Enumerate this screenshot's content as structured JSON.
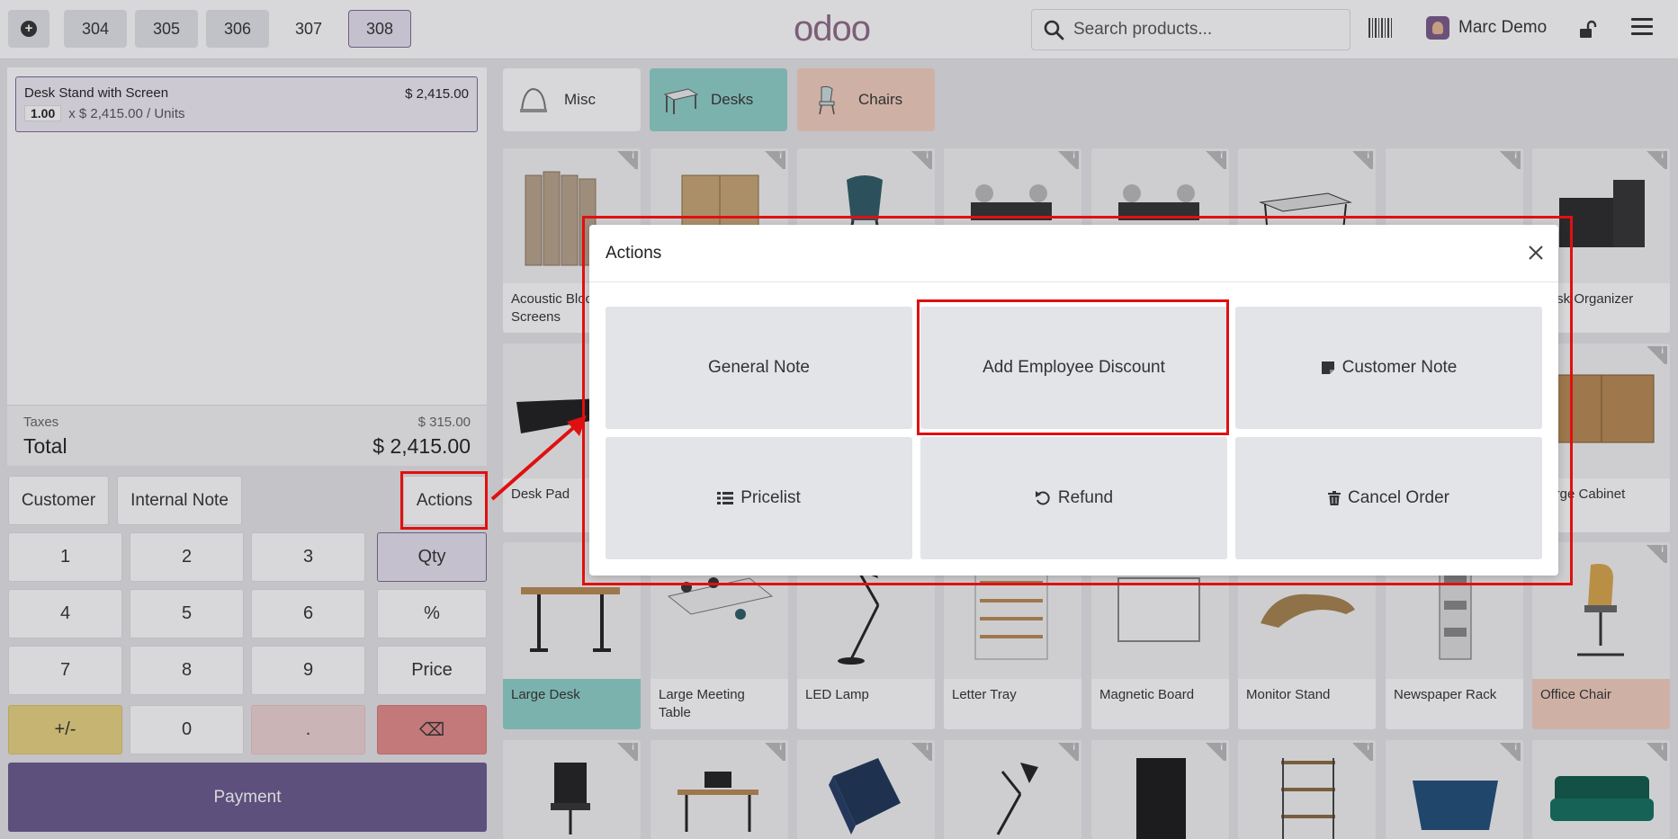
{
  "topbar": {
    "new_order_icon": "plus-circle-icon",
    "tabs": [
      "304",
      "305",
      "306",
      "307",
      "308"
    ],
    "active_tab": "308",
    "logo": "odoo",
    "search_placeholder": "Search products...",
    "user_name": "Marc Demo"
  },
  "order": {
    "line": {
      "name": "Desk Stand with Screen",
      "price": "$ 2,415.00",
      "qty": "1.00",
      "unit_price": "x $ 2,415.00 / Units"
    },
    "taxes_label": "Taxes",
    "taxes_value": "$ 315.00",
    "total_label": "Total",
    "total_value": "$ 2,415.00"
  },
  "controls": {
    "customer": "Customer",
    "internal_note": "Internal Note",
    "actions": "Actions"
  },
  "numpad": {
    "k1": "1",
    "k2": "2",
    "k3": "3",
    "k4": "4",
    "k5": "5",
    "k6": "6",
    "k7": "7",
    "k8": "8",
    "k9": "9",
    "k0": "0",
    "dot": ".",
    "plusminus": "+/-",
    "qty": "Qty",
    "percent": "%",
    "price": "Price",
    "backspace": "⌫"
  },
  "payment": "Payment",
  "categories": [
    "Misc",
    "Desks",
    "Chairs"
  ],
  "products": {
    "row1_first": "Acoustic Bloc Screens",
    "row1_last": "Desk Organizer",
    "row2_first": "Desk Pad",
    "row2_last": "Large Cabinet",
    "row3": [
      "Large Desk",
      "Large Meeting Table",
      "LED Lamp",
      "Letter Tray",
      "Magnetic Board",
      "Monitor Stand",
      "Newspaper Rack",
      "Office Chair"
    ]
  },
  "modal": {
    "title": "Actions",
    "buttons": {
      "general_note": "General Note",
      "employee_discount": "Add Employee Discount",
      "customer_note": "Customer Note",
      "pricelist": "Pricelist",
      "refund": "Refund",
      "cancel_order": "Cancel Order"
    }
  },
  "colors": {
    "accent": "#6a5a8e",
    "highlight": "#e01010",
    "desks_category": "#8fd1c8",
    "chairs_category": "#f3d0bd",
    "plusminus_key": "#e8d480",
    "backspace_key": "#e68a8a"
  }
}
